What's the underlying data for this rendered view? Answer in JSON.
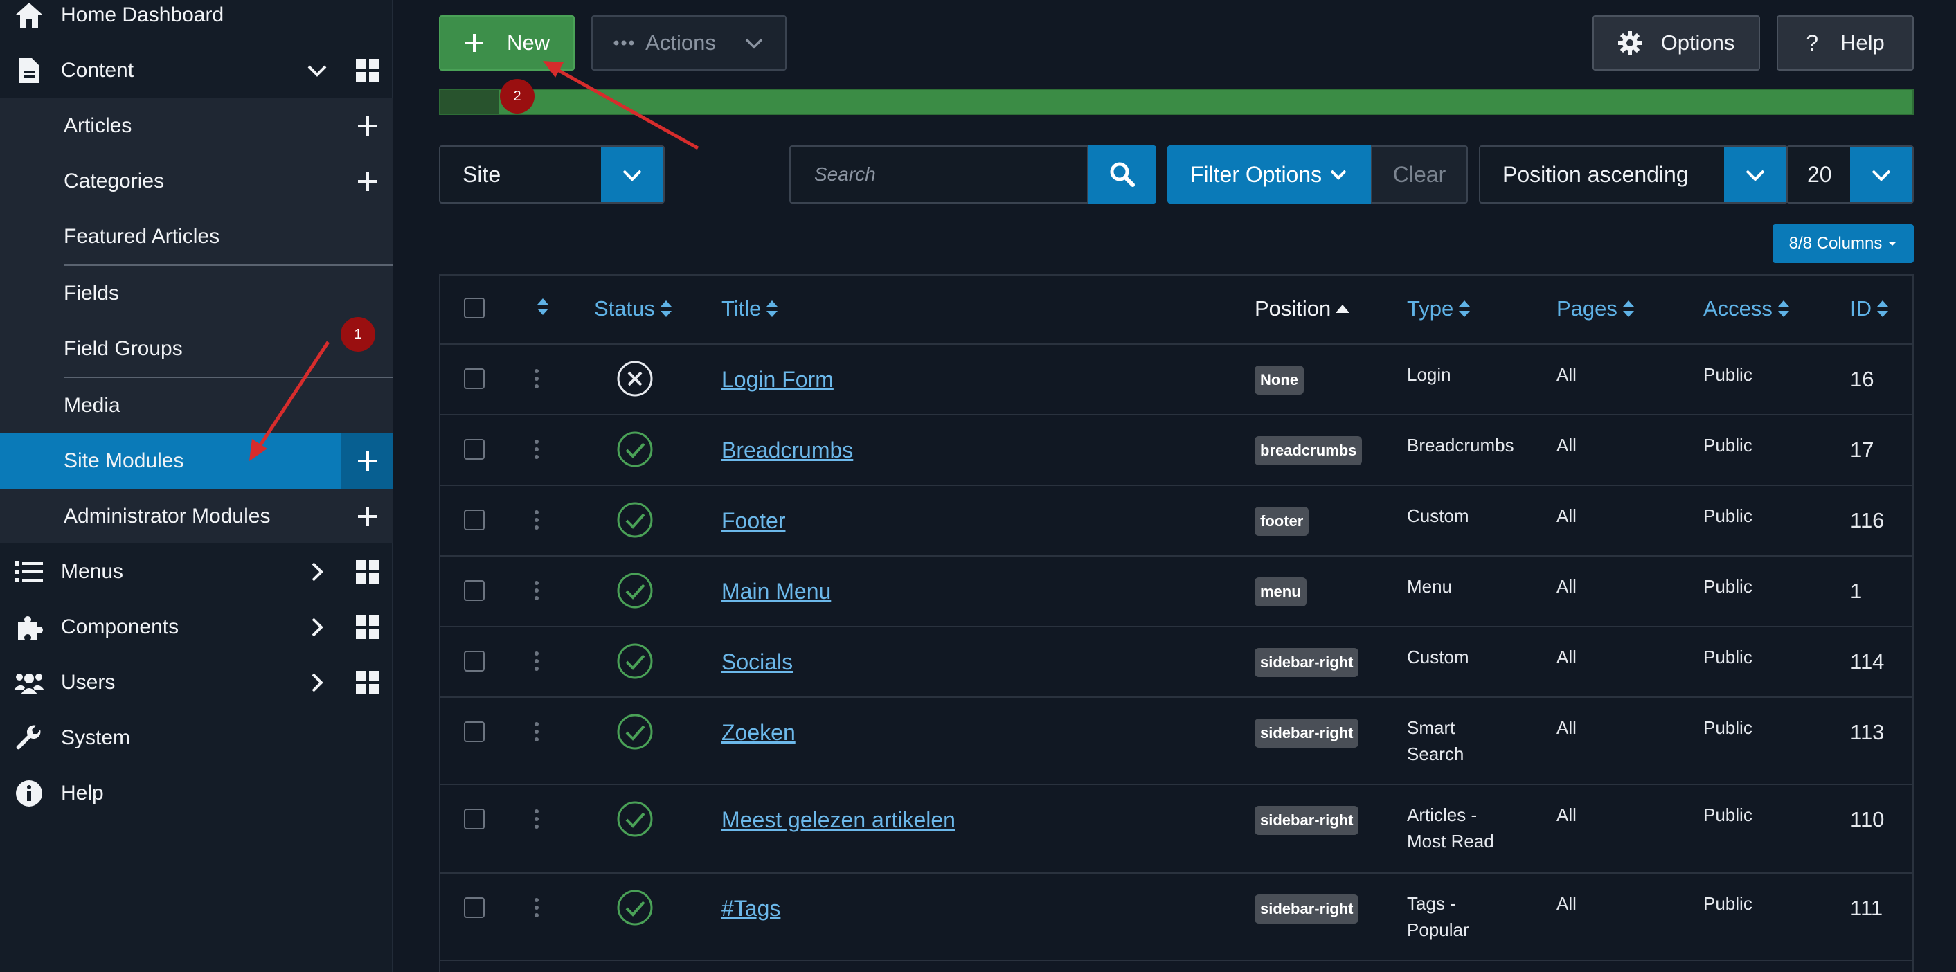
{
  "sidebar": {
    "items": [
      {
        "label": "Home Dashboard",
        "icon": "home-icon"
      },
      {
        "label": "Content",
        "icon": "file-icon"
      },
      {
        "label": "Menus",
        "icon": "list-icon"
      },
      {
        "label": "Components",
        "icon": "puzzle-icon"
      },
      {
        "label": "Users",
        "icon": "users-icon"
      },
      {
        "label": "System",
        "icon": "wrench-icon"
      },
      {
        "label": "Help",
        "icon": "info-icon"
      }
    ],
    "content_sub": [
      {
        "label": "Articles"
      },
      {
        "label": "Categories"
      },
      {
        "label": "Featured Articles"
      },
      {
        "label": "Fields"
      },
      {
        "label": "Field Groups"
      },
      {
        "label": "Media"
      },
      {
        "label": "Site Modules"
      },
      {
        "label": "Administrator Modules"
      }
    ]
  },
  "toolbar": {
    "new_label": "New",
    "actions_label": "Actions",
    "options_label": "Options",
    "help_label": "Help"
  },
  "filters": {
    "client_value": "Site",
    "search_placeholder": "Search",
    "filter_options_label": "Filter Options",
    "clear_label": "Clear",
    "ordering_value": "Position ascending",
    "limit_value": "20",
    "columns_label": "8/8 Columns"
  },
  "table": {
    "headers": {
      "status": "Status",
      "title": "Title",
      "position": "Position",
      "type": "Type",
      "pages": "Pages",
      "access": "Access",
      "id": "ID"
    },
    "rows": [
      {
        "status": "unpublished",
        "title": "Login Form",
        "position": "None",
        "type": [
          "Login"
        ],
        "pages": "All",
        "access": "Public",
        "id": "16"
      },
      {
        "status": "published",
        "title": "Breadcrumbs",
        "position": "breadcrumbs",
        "type": [
          "Breadcrumbs"
        ],
        "pages": "All",
        "access": "Public",
        "id": "17"
      },
      {
        "status": "published",
        "title": "Footer",
        "position": "footer",
        "type": [
          "Custom"
        ],
        "pages": "All",
        "access": "Public",
        "id": "116"
      },
      {
        "status": "published",
        "title": "Main Menu",
        "position": "menu",
        "type": [
          "Menu"
        ],
        "pages": "All",
        "access": "Public",
        "id": "1"
      },
      {
        "status": "published",
        "title": "Socials",
        "position": "sidebar-right",
        "type": [
          "Custom"
        ],
        "pages": "All",
        "access": "Public",
        "id": "114"
      },
      {
        "status": "published",
        "title": "Zoeken",
        "position": "sidebar-right",
        "type": [
          "Smart",
          "Search"
        ],
        "pages": "All",
        "access": "Public",
        "id": "113"
      },
      {
        "status": "published",
        "title": "Meest gelezen artikelen",
        "position": "sidebar-right",
        "type": [
          "Articles -",
          "Most Read"
        ],
        "pages": "All",
        "access": "Public",
        "id": "110"
      },
      {
        "status": "published",
        "title": "#Tags",
        "position": "sidebar-right",
        "type": [
          "Tags -",
          "Popular"
        ],
        "pages": "All",
        "access": "Public",
        "id": "111"
      }
    ]
  },
  "annotations": {
    "marker1": "1",
    "marker2": "2"
  },
  "colors": {
    "accent": "#0a7ab8",
    "success": "#3d8f4a",
    "link": "#6cb8ea",
    "annotation": "#9a0f10",
    "arrow": "#d62c2c"
  }
}
